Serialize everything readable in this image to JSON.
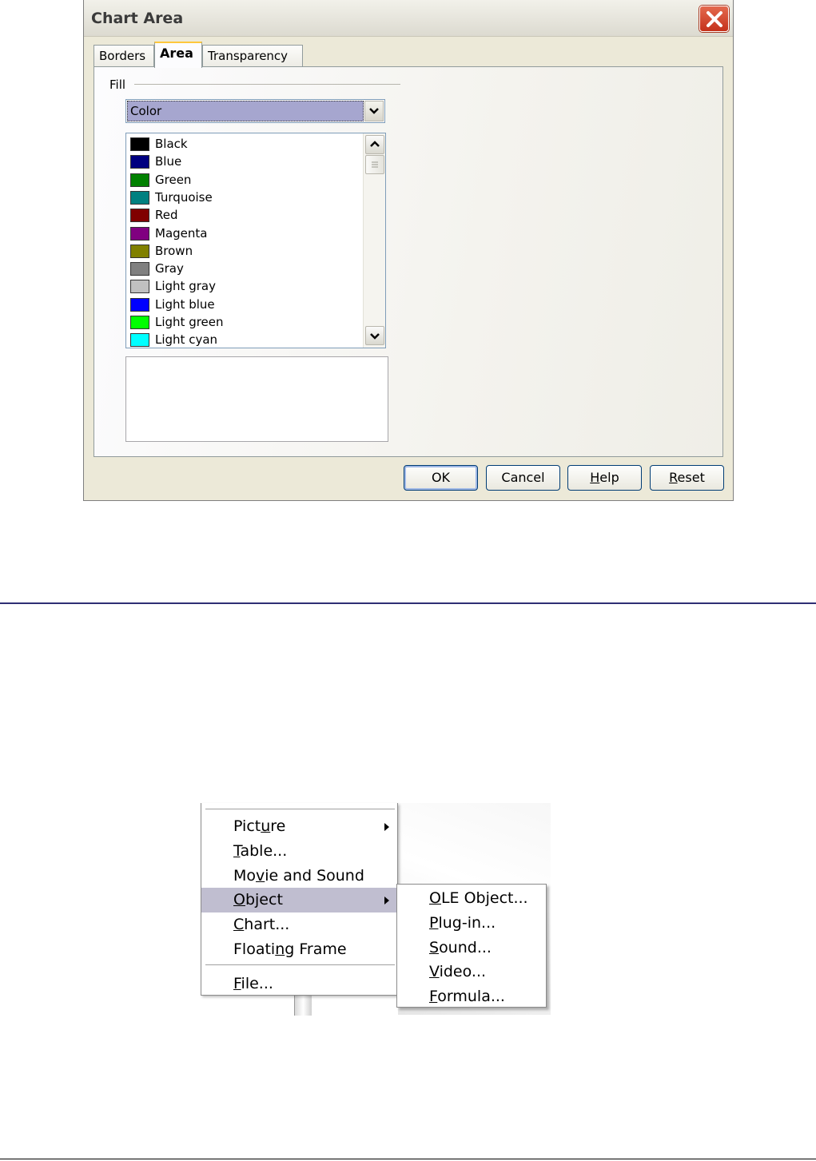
{
  "dialog": {
    "title": "Chart Area",
    "tabs": [
      {
        "label": "Borders",
        "active": false
      },
      {
        "label": "Area",
        "active": true
      },
      {
        "label": "Transparency",
        "active": false
      }
    ],
    "fill_label": "Fill",
    "fill_select_value": "Color",
    "colors": [
      {
        "name": "Black",
        "hex": "#000000"
      },
      {
        "name": "Blue",
        "hex": "#000080"
      },
      {
        "name": "Green",
        "hex": "#008000"
      },
      {
        "name": "Turquoise",
        "hex": "#008080"
      },
      {
        "name": "Red",
        "hex": "#800000"
      },
      {
        "name": "Magenta",
        "hex": "#800080"
      },
      {
        "name": "Brown",
        "hex": "#808000"
      },
      {
        "name": "Gray",
        "hex": "#808080"
      },
      {
        "name": "Light gray",
        "hex": "#c0c0c0"
      },
      {
        "name": "Light blue",
        "hex": "#0000ff"
      },
      {
        "name": "Light green",
        "hex": "#00ff00"
      },
      {
        "name": "Light cyan",
        "hex": "#00ffff"
      }
    ],
    "buttons": {
      "ok": "OK",
      "cancel": "Cancel",
      "help": {
        "pre": "",
        "u": "H",
        "post": "elp"
      },
      "reset": {
        "pre": "",
        "u": "R",
        "post": "eset"
      }
    }
  },
  "menu": {
    "items": [
      {
        "pre": "Pict",
        "u": "u",
        "post": "re",
        "submenu": true,
        "highlighted": false
      },
      {
        "pre": "",
        "u": "T",
        "post": "able...",
        "submenu": false,
        "highlighted": false
      },
      {
        "pre": "Mo",
        "u": "v",
        "post": "ie and Sound",
        "submenu": false,
        "highlighted": false
      },
      {
        "pre": "",
        "u": "O",
        "post": "bject",
        "submenu": true,
        "highlighted": true
      },
      {
        "pre": "",
        "u": "C",
        "post": "hart...",
        "submenu": false,
        "highlighted": false
      },
      {
        "pre": "Floati",
        "u": "n",
        "post": "g Frame",
        "submenu": false,
        "highlighted": false
      }
    ],
    "file_item": {
      "pre": "",
      "u": "F",
      "post": "ile..."
    }
  },
  "submenu": {
    "items": [
      {
        "pre": "",
        "u": "O",
        "post": "LE Object..."
      },
      {
        "pre": "",
        "u": "P",
        "post": "lug-in..."
      },
      {
        "pre": "",
        "u": "S",
        "post": "ound..."
      },
      {
        "pre": "",
        "u": "V",
        "post": "ideo..."
      },
      {
        "pre": "",
        "u": "F",
        "post": "ormula..."
      }
    ]
  },
  "colors": {
    "dialog_bg": "#ece9d8",
    "highlight": "#c0bed0",
    "rule": "#2e2e74"
  }
}
